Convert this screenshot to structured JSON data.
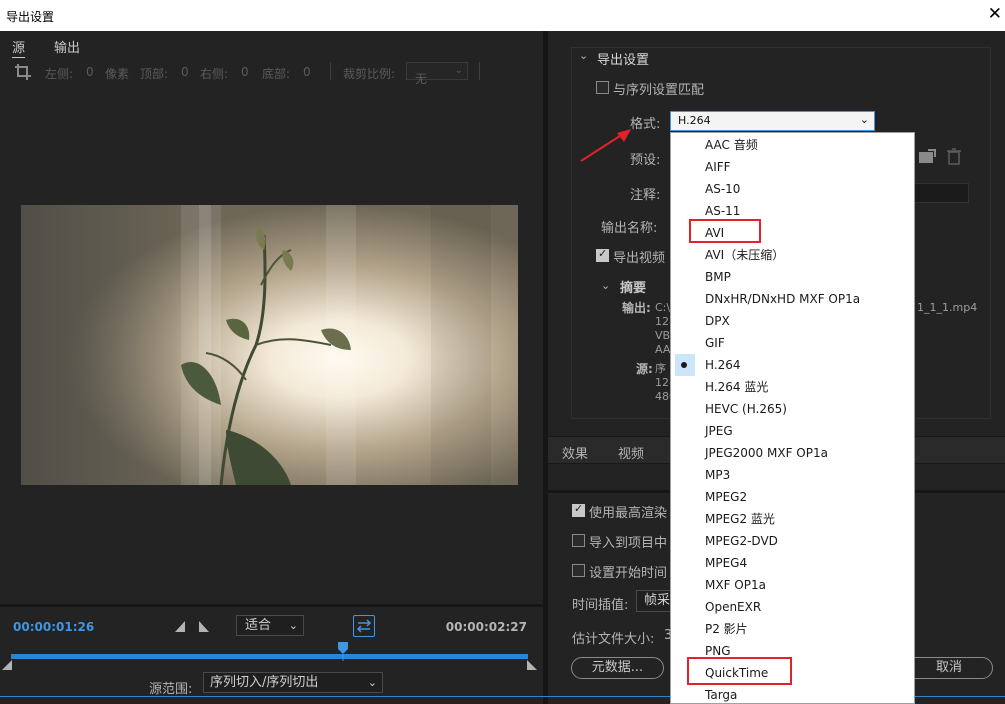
{
  "window": {
    "title": "导出设置"
  },
  "left": {
    "tabs": [
      "源",
      "输出"
    ],
    "crop": {
      "left_label": "左侧:",
      "left_value": "0",
      "unit": "像素",
      "top_label": "顶部:",
      "top_value": "0",
      "right_label": "右侧:",
      "right_value": "0",
      "bottom_label": "底部:",
      "bottom_value": "0",
      "ratio_label": "裁剪比例:",
      "ratio_value": "无"
    },
    "timeline": {
      "current_tc": "00:00:01:26",
      "end_tc": "00:00:02:27",
      "fit_value": "适合",
      "range_label": "源范围:",
      "range_value": "序列切入/序列切出"
    }
  },
  "right": {
    "section_title": "导出设置",
    "match_sequence_label": "与序列设置匹配",
    "format_label": "格式:",
    "format_value": "H.264",
    "preset_label": "预设:",
    "comments_label": "注释:",
    "output_name_label": "输出名称:",
    "output_name_value": "1_1_1.mp4",
    "export_video_label": "导出视频",
    "summary_label": "摘要",
    "summary_output_label": "输出:",
    "summary_output_lines": [
      "C:\\",
      "128",
      "VB",
      "AA"
    ],
    "summary_source_label": "源:",
    "summary_source_lines": [
      "序",
      "128",
      "480"
    ],
    "panel_tabs": [
      "效果",
      "视频"
    ],
    "use_max_render_label": "使用最高渲染",
    "import_to_project_label": "导入到项目中",
    "set_start_tc_label": "设置开始时间",
    "time_interp_label": "时间插值:",
    "time_interp_value": "帧采",
    "est_size_label": "估计文件大小:",
    "est_size_value": "3",
    "metadata_button": "元数据...",
    "cancel_button": "取消"
  },
  "dropdown": {
    "options": [
      "AAC 音频",
      "AIFF",
      "AS-10",
      "AS-11",
      "AVI",
      "AVI（未压缩）",
      "BMP",
      "DNxHR/DNxHD MXF OP1a",
      "DPX",
      "GIF",
      "H.264",
      "H.264 蓝光",
      "HEVC (H.265)",
      "JPEG",
      "JPEG2000 MXF OP1a",
      "MP3",
      "MPEG2",
      "MPEG2 蓝光",
      "MPEG2-DVD",
      "MPEG4",
      "MXF OP1a",
      "OpenEXR",
      "P2 影片",
      "PNG",
      "QuickTime",
      "Targa"
    ],
    "selected": "H.264",
    "highlighted": [
      "AVI",
      "QuickTime"
    ]
  },
  "colors": {
    "accent": "#3d97e3",
    "annotation_red": "#e32129",
    "selection_bg": "#cde6f7"
  }
}
